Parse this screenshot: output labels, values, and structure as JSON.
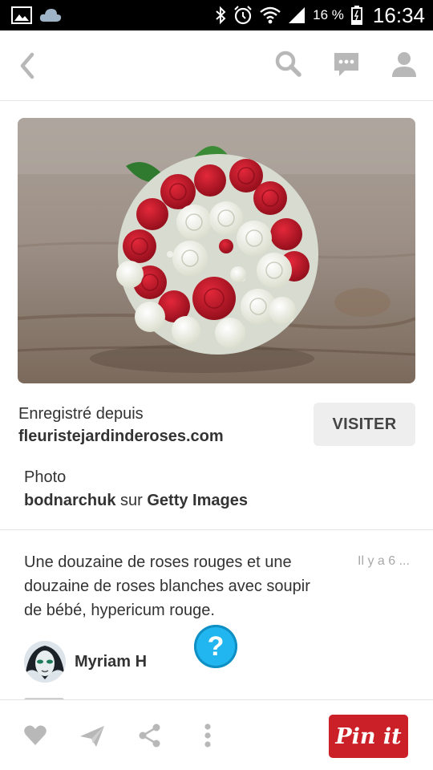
{
  "status_bar": {
    "battery_percent": "16 %",
    "time": "16:34",
    "icons": [
      "gallery-icon",
      "cloud-icon",
      "bluetooth-icon",
      "alarm-icon",
      "wifi-icon",
      "signal-icon",
      "battery-icon"
    ]
  },
  "header": {
    "icons": [
      "back-icon",
      "search-icon",
      "messages-icon",
      "profile-icon"
    ]
  },
  "source": {
    "saved_from_label": "Enregistré depuis",
    "domain": "fleuristejardinderoses.com",
    "visit_label": "VISITER"
  },
  "credit": {
    "photo_label": "Photo",
    "author": "bodnarchuk",
    "connector": "sur",
    "agency": "Getty Images"
  },
  "pin": {
    "description": "Une douzaine de roses rouges et une douzaine de roses blanches avec soupir de bébé, hypericum rouge.",
    "time_ago": "Il y a 6 ...",
    "user_name": "Myriam H"
  },
  "help": {
    "label": "?"
  },
  "bottom_bar": {
    "icons": [
      "like-icon",
      "send-icon",
      "share-icon",
      "more-icon"
    ],
    "pin_it_label": "Pin it"
  },
  "colors": {
    "pin_red": "#cb2027",
    "help_blue": "#22b6f0",
    "icon_gray": "#b8b8b8"
  }
}
